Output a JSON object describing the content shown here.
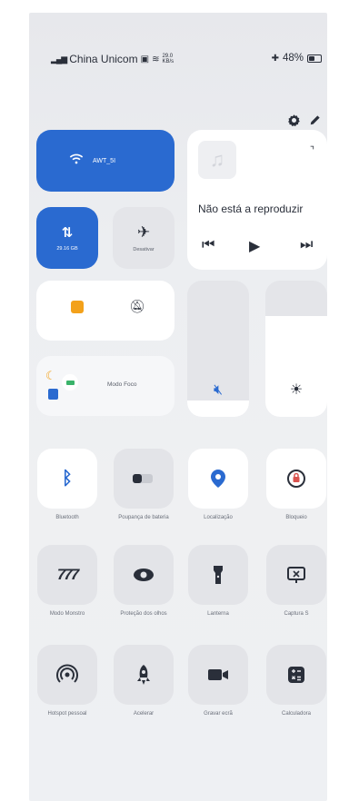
{
  "status": {
    "carrier": "China Unicom",
    "speed": "29.0 KB/s",
    "battery": "48%"
  },
  "tiles": {
    "wifi_label": "AWT_5I",
    "mobile_data_label": "29.16 GB",
    "airplane_label": "Desativar",
    "media_status": "Não está a reproduzir",
    "focus_label": "Modo Foco"
  },
  "quick_buttons": [
    {
      "label": "Bluetooth",
      "icon": "bluetooth-icon"
    },
    {
      "label": "Poupança de bateria",
      "icon": "battery-saver-icon"
    },
    {
      "label": "Localização",
      "icon": "location-icon"
    },
    {
      "label": "Bloqueio",
      "icon": "rotation-lock-icon"
    },
    {
      "label": "Modo Monstro",
      "icon": "monster-mode-icon"
    },
    {
      "label": "Proteção dos olhos",
      "icon": "eye-icon"
    },
    {
      "label": "Lanterna",
      "icon": "flashlight-icon"
    },
    {
      "label": "Captura S",
      "icon": "screenshot-icon"
    },
    {
      "label": "Hotspot pessoal",
      "icon": "hotspot-icon"
    },
    {
      "label": "Acelerar",
      "icon": "rocket-icon"
    },
    {
      "label": "Gravar ecrã",
      "icon": "screen-record-icon"
    },
    {
      "label": "Calculadora",
      "icon": "calculator-icon"
    }
  ],
  "sliders": {
    "volume_level": 0.12,
    "brightness_level": 0.74
  },
  "colors": {
    "accent": "#2a6ad0",
    "warning": "#f3a11a",
    "background": "#eceef1"
  }
}
